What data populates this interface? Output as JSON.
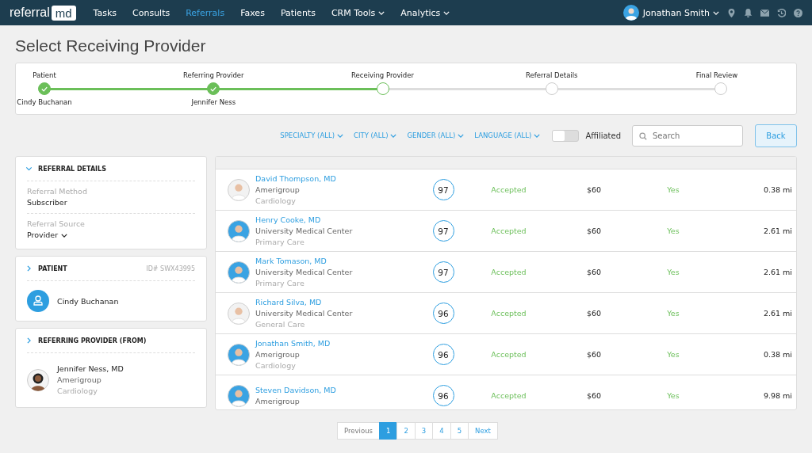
{
  "nav": {
    "logo_left": "referral",
    "logo_right": "md",
    "items": [
      {
        "label": "Tasks",
        "selected": false,
        "dropdown": false
      },
      {
        "label": "Consults",
        "selected": false,
        "dropdown": false
      },
      {
        "label": "Referrals",
        "selected": true,
        "dropdown": false
      },
      {
        "label": "Faxes",
        "selected": false,
        "dropdown": false
      },
      {
        "label": "Patients",
        "selected": false,
        "dropdown": false
      },
      {
        "label": "CRM Tools",
        "selected": false,
        "dropdown": true
      },
      {
        "label": "Analytics",
        "selected": false,
        "dropdown": true
      }
    ],
    "user": "Jonathan Smith"
  },
  "page_title": "Select Receiving Provider",
  "steps": [
    {
      "label": "Patient",
      "value": "Cindy Buchanan",
      "completed": true,
      "current": false
    },
    {
      "label": "Referring Provider",
      "value": "Jennifer Ness",
      "completed": true,
      "current": false
    },
    {
      "label": "Receiving Provider",
      "completed": false,
      "current": true
    },
    {
      "label": "Referral Details",
      "completed": false,
      "current": false
    },
    {
      "label": "Final Review",
      "completed": false,
      "current": false
    }
  ],
  "filters": [
    "SPECIALTY (ALL)",
    "CITY (ALL)",
    "GENDER (ALL)",
    "LANGUAGE (ALL)"
  ],
  "affiliated": {
    "label": "Affiliated",
    "on": false
  },
  "search": {
    "placeholder": "Search"
  },
  "back_button": "Back",
  "referral_details": {
    "title": "REFERRAL DETAILS",
    "expanded": true,
    "method_label": "Referral Method",
    "method": "Subscriber",
    "source_label": "Referral Source",
    "source": "Provider"
  },
  "patient": {
    "title": "PATIENT",
    "expanded": false,
    "id": "ID# SWX43995",
    "name": "Cindy Buchanan"
  },
  "referring_provider": {
    "title": "REFERRING PROVIDER (FROM)",
    "expanded": false,
    "name": "Jennifer Ness, MD",
    "org": "Amerigroup",
    "specialty": "Cardiology"
  },
  "providers": [
    {
      "name": "David Thompson, MD",
      "org": "Amerigroup",
      "specialty": "Cardiology",
      "score": "97",
      "status": "Accepted",
      "price": "$60",
      "in_network": "Yes",
      "distance": "0.38 mi"
    },
    {
      "name": "Henry Cooke, MD",
      "org": "University Medical Center",
      "specialty": "Primary Care",
      "score": "97",
      "status": "Accepted",
      "price": "$60",
      "in_network": "Yes",
      "distance": "2.61 mi"
    },
    {
      "name": "Mark Tomason, MD",
      "org": "University Medical Center",
      "specialty": "Primary Care",
      "score": "97",
      "status": "Accepted",
      "price": "$60",
      "in_network": "Yes",
      "distance": "2.61 mi"
    },
    {
      "name": "Richard Silva, MD",
      "org": "University Medical Center",
      "specialty": "General Care",
      "score": "96",
      "status": "Accepted",
      "price": "$60",
      "in_network": "Yes",
      "distance": "2.61 mi"
    },
    {
      "name": "Jonathan Smith, MD",
      "org": "Amerigroup",
      "specialty": "Cardiology",
      "score": "96",
      "status": "Accepted",
      "price": "$60",
      "in_network": "Yes",
      "distance": "0.38 mi"
    },
    {
      "name": "Steven Davidson, MD",
      "org": "Amerigroup",
      "score": "96",
      "status": "Accepted",
      "price": "$60",
      "in_network": "Yes",
      "distance": "9.98 mi"
    }
  ],
  "pagination": {
    "previous": "Previous",
    "pages": [
      {
        "label": "1",
        "selected": true
      },
      {
        "label": "2",
        "selected": false
      },
      {
        "label": "3",
        "selected": false
      },
      {
        "label": "4",
        "selected": false
      },
      {
        "label": "5",
        "selected": false
      }
    ],
    "next": "Next"
  }
}
